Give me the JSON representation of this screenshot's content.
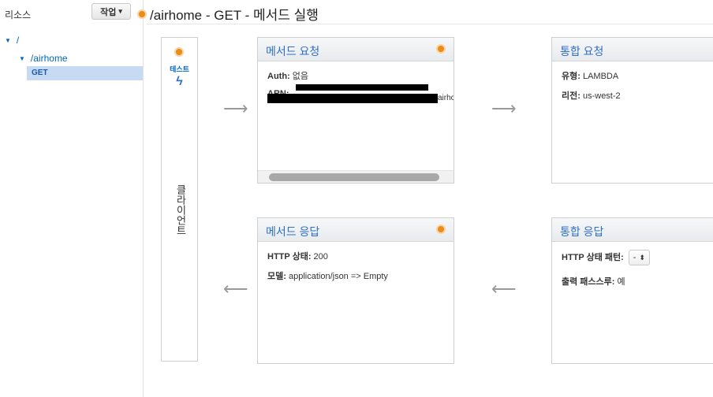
{
  "sidebar": {
    "title": "리소스",
    "action_label": "작업",
    "action_caret": "▾",
    "tree": [
      {
        "label": "/"
      },
      {
        "label": "/airhome"
      },
      {
        "label": "GET"
      }
    ]
  },
  "header": {
    "title": "/airhome - GET - 메서드 실행"
  },
  "client": {
    "test_label": "테스트",
    "bolt": "ϟ",
    "label": "클라이언트"
  },
  "method_request": {
    "title": "메서드 요청",
    "auth_label": "Auth:",
    "auth_value": "없음",
    "arn_label": "ARN:",
    "arn_tail": "airhc"
  },
  "integration_request": {
    "title": "통합 요청",
    "type_label": "유형:",
    "type_value": "LAMBDA",
    "region_label": "리전:",
    "region_value": "us-west-2"
  },
  "method_response": {
    "title": "메서드 응답",
    "http_label": "HTTP 상태:",
    "http_value": "200",
    "model_label": "모델:",
    "model_value": "application/json => Empty"
  },
  "integration_response": {
    "title": "통합 응답",
    "pattern_label": "HTTP 상태 패턴:",
    "pattern_value": "-",
    "passthrough_label": "출력 패스스루:",
    "passthrough_value": "예"
  },
  "arrows": {
    "right": "⟶",
    "left": "⟵"
  },
  "icons": {
    "status_dot": "orange-dot",
    "tree_expand": "triangle-down",
    "bolt": "lightning-bolt",
    "updown": "sort-arrows"
  },
  "colors": {
    "accent": "#eb8c16",
    "link": "#0066c0",
    "selected": "#c6dbf3"
  }
}
